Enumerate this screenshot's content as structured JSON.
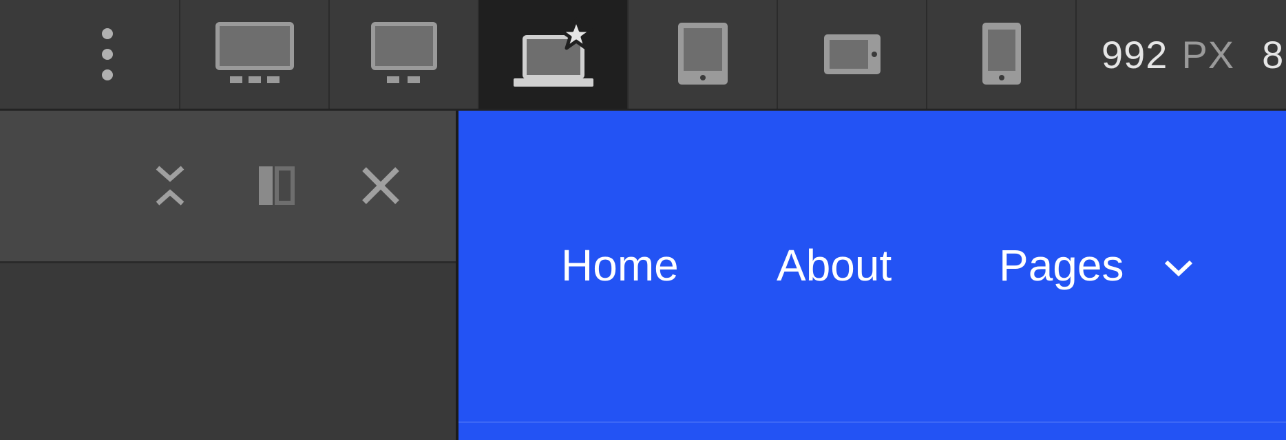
{
  "toolbar": {
    "breakpoints": [
      {
        "icon": "more-vertical-icon"
      },
      {
        "icon": "desktop-xl-icon"
      },
      {
        "icon": "desktop-icon"
      },
      {
        "icon": "laptop-base-breakpoint-icon",
        "active": true
      },
      {
        "icon": "tablet-portrait-icon"
      },
      {
        "icon": "tablet-landscape-icon"
      },
      {
        "icon": "mobile-portrait-icon"
      }
    ],
    "width_value": "992",
    "width_unit": "PX",
    "width_next": "8"
  },
  "panel": {
    "buttons": [
      {
        "icon": "collapse-icon"
      },
      {
        "icon": "dock-panel-icon"
      },
      {
        "icon": "close-icon"
      }
    ]
  },
  "preview": {
    "background": "#2353f4",
    "nav": {
      "home": "Home",
      "about": "About",
      "pages": "Pages"
    }
  },
  "colors": {
    "toolbar_bg": "#3a3a3a",
    "active_bg": "#1f1f1f",
    "panel_header_bg": "#474747",
    "panel_body_bg": "#393939",
    "preview_bg": "#2353f4"
  }
}
